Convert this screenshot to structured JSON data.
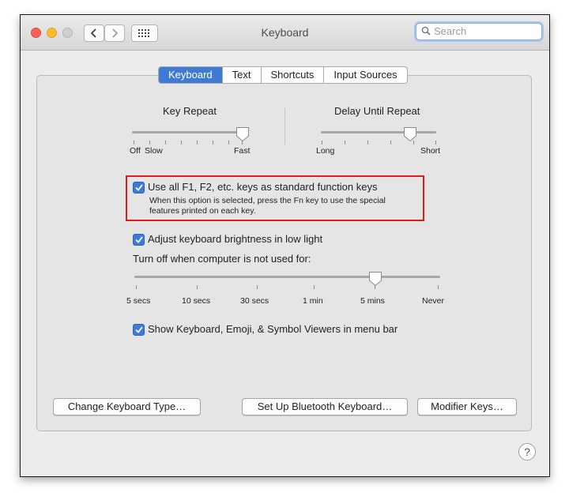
{
  "window": {
    "title": "Keyboard"
  },
  "search": {
    "placeholder": "Search"
  },
  "tabs": [
    {
      "label": "Keyboard",
      "active": true
    },
    {
      "label": "Text"
    },
    {
      "label": "Shortcuts"
    },
    {
      "label": "Input Sources"
    }
  ],
  "key_repeat": {
    "title": "Key Repeat",
    "min_label": "Off",
    "low_label": "Slow",
    "max_label": "Fast",
    "value_fraction": 1.0
  },
  "delay_until_repeat": {
    "title": "Delay Until Repeat",
    "min_label": "Long",
    "max_label": "Short",
    "value_fraction": 0.8
  },
  "function_keys": {
    "label": "Use all F1, F2, etc. keys as standard function keys",
    "checked": true,
    "description_line1": "When this option is selected, press the Fn key to use the special",
    "description_line2": "features printed on each key."
  },
  "brightness": {
    "label": "Adjust keyboard brightness in low light",
    "checked": true
  },
  "turn_off": {
    "label": "Turn off when computer is not used for:",
    "ticks": [
      "5 secs",
      "10 secs",
      "30 secs",
      "1 min",
      "5 mins",
      "Never"
    ],
    "selected": "5 mins"
  },
  "viewers": {
    "label": "Show Keyboard, Emoji, & Symbol Viewers in menu bar",
    "checked": true
  },
  "buttons": {
    "change_type": "Change Keyboard Type…",
    "bluetooth": "Set Up Bluetooth Keyboard…",
    "modifier": "Modifier Keys…"
  },
  "help": "?",
  "colors": {
    "accent": "#3f7ad6",
    "highlight_box": "#e01b1b"
  }
}
